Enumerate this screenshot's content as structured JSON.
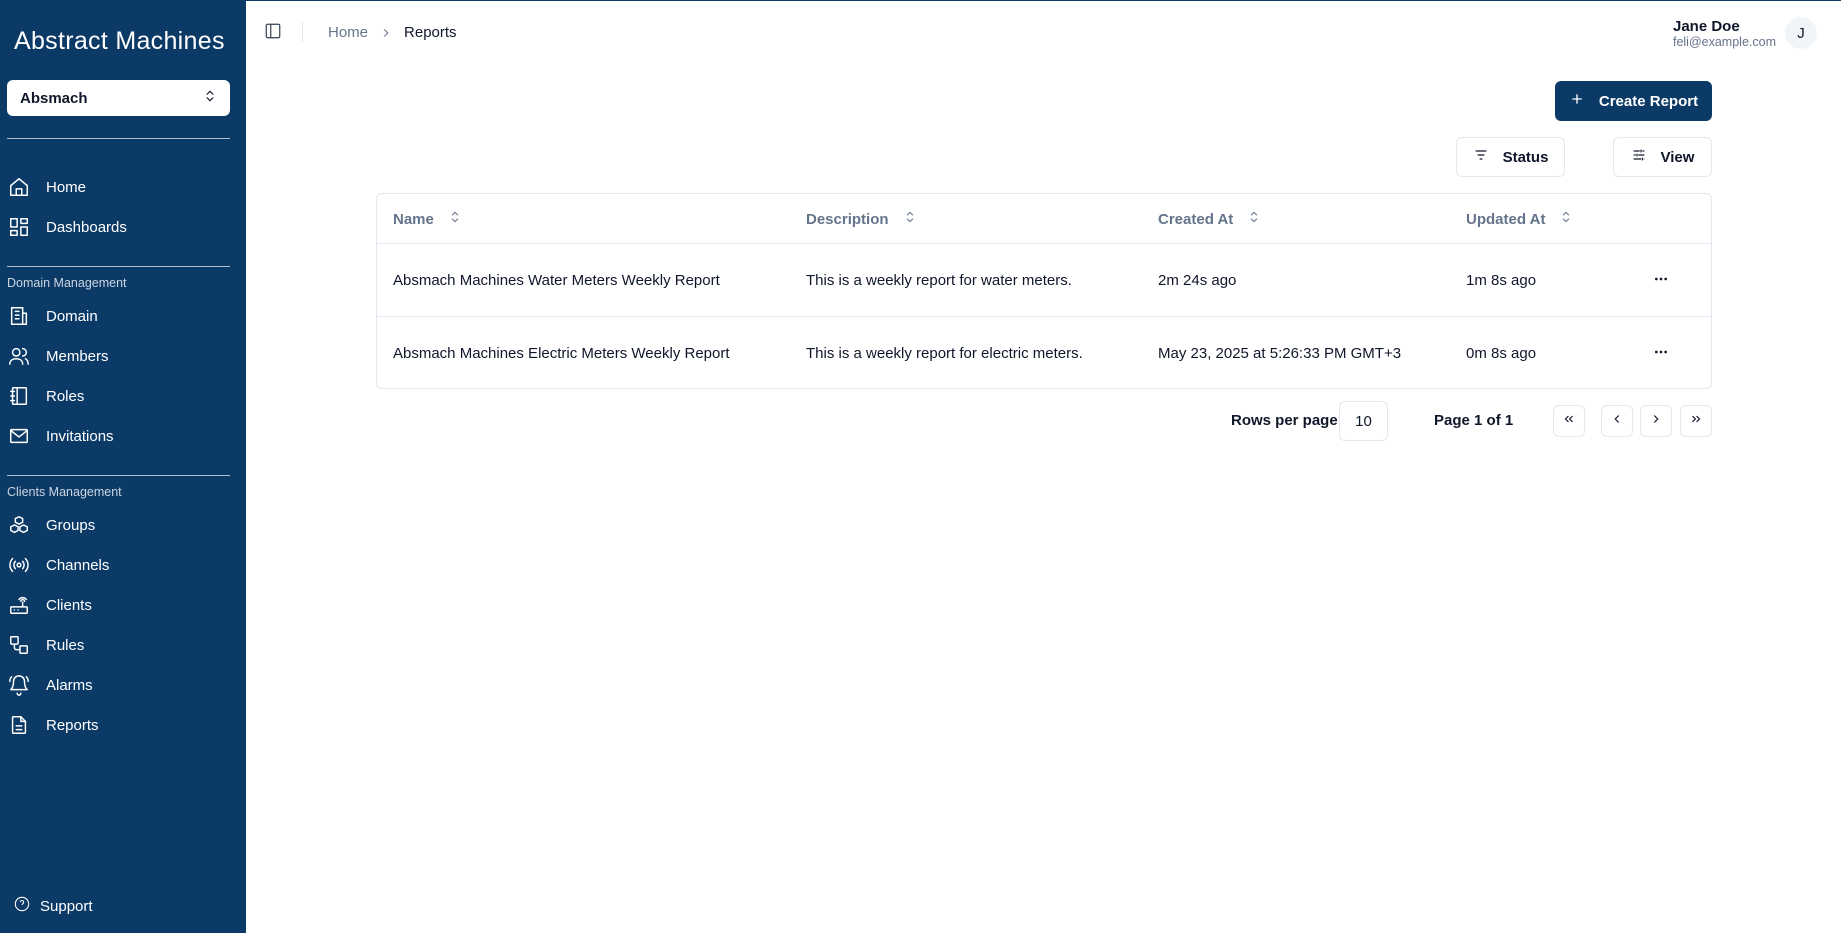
{
  "brand": {
    "logo_text": "Abstract Machines"
  },
  "org_selector": {
    "value": "Absmach"
  },
  "sidebar": {
    "top_items": [
      {
        "label": "Home",
        "icon": "home-icon"
      },
      {
        "label": "Dashboards",
        "icon": "dashboard-icon"
      }
    ],
    "domain_section_label": "Domain Management",
    "domain_items": [
      {
        "label": "Domain",
        "icon": "building-icon"
      },
      {
        "label": "Members",
        "icon": "users-icon"
      },
      {
        "label": "Roles",
        "icon": "notebook-icon"
      },
      {
        "label": "Invitations",
        "icon": "mail-icon"
      }
    ],
    "clients_section_label": "Clients Management",
    "clients_items": [
      {
        "label": "Groups",
        "icon": "boxes-icon"
      },
      {
        "label": "Channels",
        "icon": "radio-icon"
      },
      {
        "label": "Clients",
        "icon": "router-icon"
      },
      {
        "label": "Rules",
        "icon": "workflow-icon"
      },
      {
        "label": "Alarms",
        "icon": "bell-icon"
      },
      {
        "label": "Reports",
        "icon": "file-icon"
      }
    ],
    "support_label": "Support"
  },
  "header": {
    "breadcrumb": {
      "home": "Home",
      "current": "Reports"
    },
    "user": {
      "name": "Jane Doe",
      "email": "feli@example.com",
      "avatar_initial": "J"
    }
  },
  "actions": {
    "create_label": "Create Report",
    "status_label": "Status",
    "view_label": "View"
  },
  "table": {
    "columns": [
      "Name",
      "Description",
      "Created At",
      "Updated At"
    ],
    "rows": [
      {
        "name": "Absmach Machines Water Meters Weekly Report",
        "description": "This is a weekly report for water meters.",
        "created_at": "2m 24s ago",
        "updated_at": "1m 8s ago"
      },
      {
        "name": "Absmach Machines Electric Meters Weekly Report",
        "description": "This is a weekly report for electric meters.",
        "created_at": "May 23, 2025 at 5:26:33 PM GMT+3",
        "updated_at": "0m 8s ago"
      }
    ]
  },
  "pagination": {
    "rows_per_page_label": "Rows per page",
    "rows_per_page_value": "10",
    "page_label": "Page 1 of 1"
  },
  "colors": {
    "sidebar_bg": "#0b3a66",
    "primary": "#0b3a66",
    "border": "#e2e8f0",
    "muted_text": "#64748b"
  }
}
